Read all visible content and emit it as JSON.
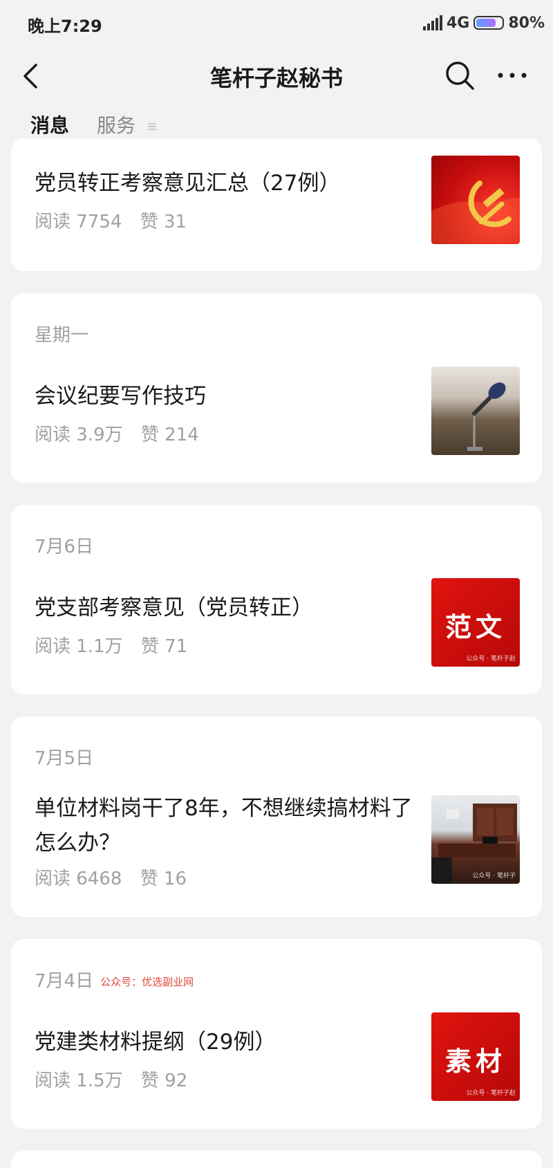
{
  "status_bar": {
    "time": "晚上7:29",
    "network": "4G",
    "battery": "80%",
    "battery_level": 0.8
  },
  "header": {
    "title": "笔杆子赵秘书"
  },
  "tabs": {
    "messages": "消息",
    "services": "服务"
  },
  "articles": [
    {
      "date": "",
      "title": "党员转正考察意见汇总（27例）",
      "reads": "阅读 7754",
      "likes": "赞 31",
      "thumb_icon": "party-emblem-image"
    },
    {
      "date": "星期一",
      "title": "会议纪要写作技巧",
      "reads": "阅读 3.9万",
      "likes": "赞 214",
      "thumb_icon": "microphone-image"
    },
    {
      "date": "7月6日",
      "title": "党支部考察意见（党员转正）",
      "reads": "阅读 1.1万",
      "likes": "赞 71",
      "thumb_text": "范文",
      "thumb_small": "公众号 · 笔杆子赵"
    },
    {
      "date": "7月5日",
      "title": "单位材料岗干了8年，不想继续搞材料了怎么办？",
      "reads": "阅读 6468",
      "likes": "赞 16",
      "thumb_icon": "office-room-image",
      "thumb_small": "公众号 · 笔杆子"
    },
    {
      "date": "7月4日",
      "watermark": "公众号：优选副业网",
      "title": "党建类材料提纲（29例）",
      "reads": "阅读 1.5万",
      "likes": "赞 92",
      "thumb_text": "素材",
      "thumb_small": "公众号 · 笔杆子赵"
    }
  ],
  "colors": {
    "background": "#f2f2f2",
    "card": "#ffffff",
    "meta_text": "#a0a0a0",
    "thumb_red": "#d40f0c"
  }
}
